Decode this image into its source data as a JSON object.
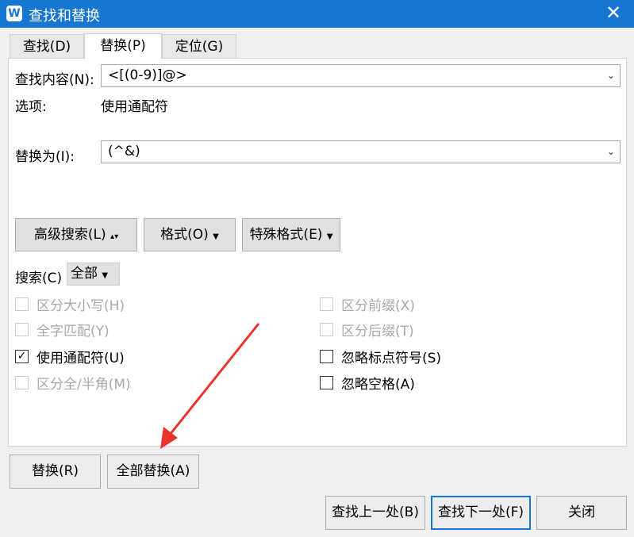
{
  "window": {
    "title": "查找和替换",
    "logo": "W"
  },
  "tabs": [
    {
      "label": "查找(D)"
    },
    {
      "label": "替换(P)"
    },
    {
      "label": "定位(G)"
    }
  ],
  "find": {
    "label": "查找内容(N):",
    "value": "<[(0-9)]@>"
  },
  "options": {
    "label": "选项:",
    "value": "使用通配符"
  },
  "replace": {
    "label": "替换为(I):",
    "value": "(^&)"
  },
  "buttons": {
    "advanced": "高级搜索(L)",
    "format": "格式(O)",
    "special": "特殊格式(E)",
    "replace": "替换(R)",
    "replace_all": "全部替换(A)",
    "find_prev": "查找上一处(B)",
    "find_next": "查找下一处(F)",
    "close": "关闭"
  },
  "search": {
    "label": "搜索(C)",
    "value": "全部"
  },
  "checkboxes": [
    {
      "label": "区分大小写(H)",
      "checked": false,
      "disabled": true
    },
    {
      "label": "全字匹配(Y)",
      "checked": false,
      "disabled": true
    },
    {
      "label": "使用通配符(U)",
      "checked": true,
      "disabled": false
    },
    {
      "label": "区分全/半角(M)",
      "checked": false,
      "disabled": true
    },
    {
      "label": "区分前缀(X)",
      "checked": false,
      "disabled": true
    },
    {
      "label": "区分后缀(T)",
      "checked": false,
      "disabled": true
    },
    {
      "label": "忽略标点符号(S)",
      "checked": false,
      "disabled": false
    },
    {
      "label": "忽略空格(A)",
      "checked": false,
      "disabled": false
    }
  ],
  "colors": {
    "titlebar": "#1677d2",
    "arrow": "#e8342c"
  }
}
